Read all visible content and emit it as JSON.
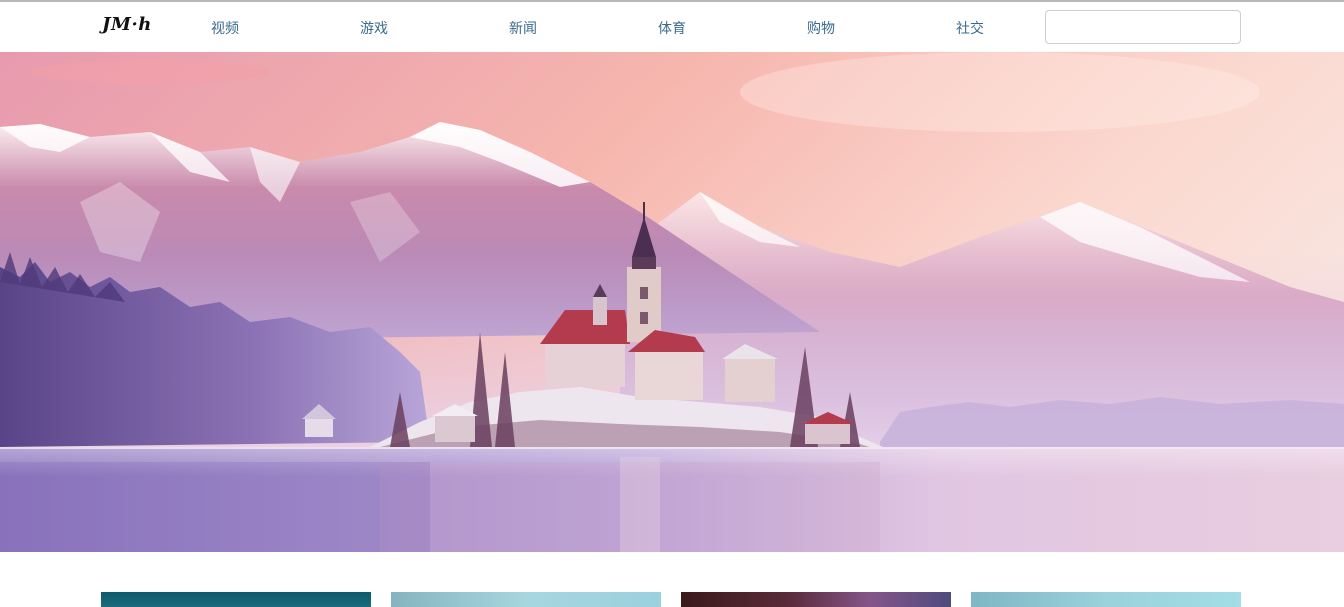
{
  "brand": {
    "logo_text": "JM·h"
  },
  "nav": {
    "items": [
      {
        "label": "视频"
      },
      {
        "label": "游戏"
      },
      {
        "label": "新闻"
      },
      {
        "label": "体育"
      },
      {
        "label": "购物"
      },
      {
        "label": "社交"
      }
    ]
  },
  "search": {
    "value": "",
    "placeholder": ""
  },
  "hero": {
    "subject": "mountain-lake-island-church"
  },
  "colors": {
    "nav_link": "#3a6b8f",
    "sky_top": "#f2a4b2",
    "lake": "#b9a6d6"
  },
  "thumbnails": [
    {
      "name": "thumb-1"
    },
    {
      "name": "thumb-2"
    },
    {
      "name": "thumb-3"
    },
    {
      "name": "thumb-4"
    }
  ]
}
